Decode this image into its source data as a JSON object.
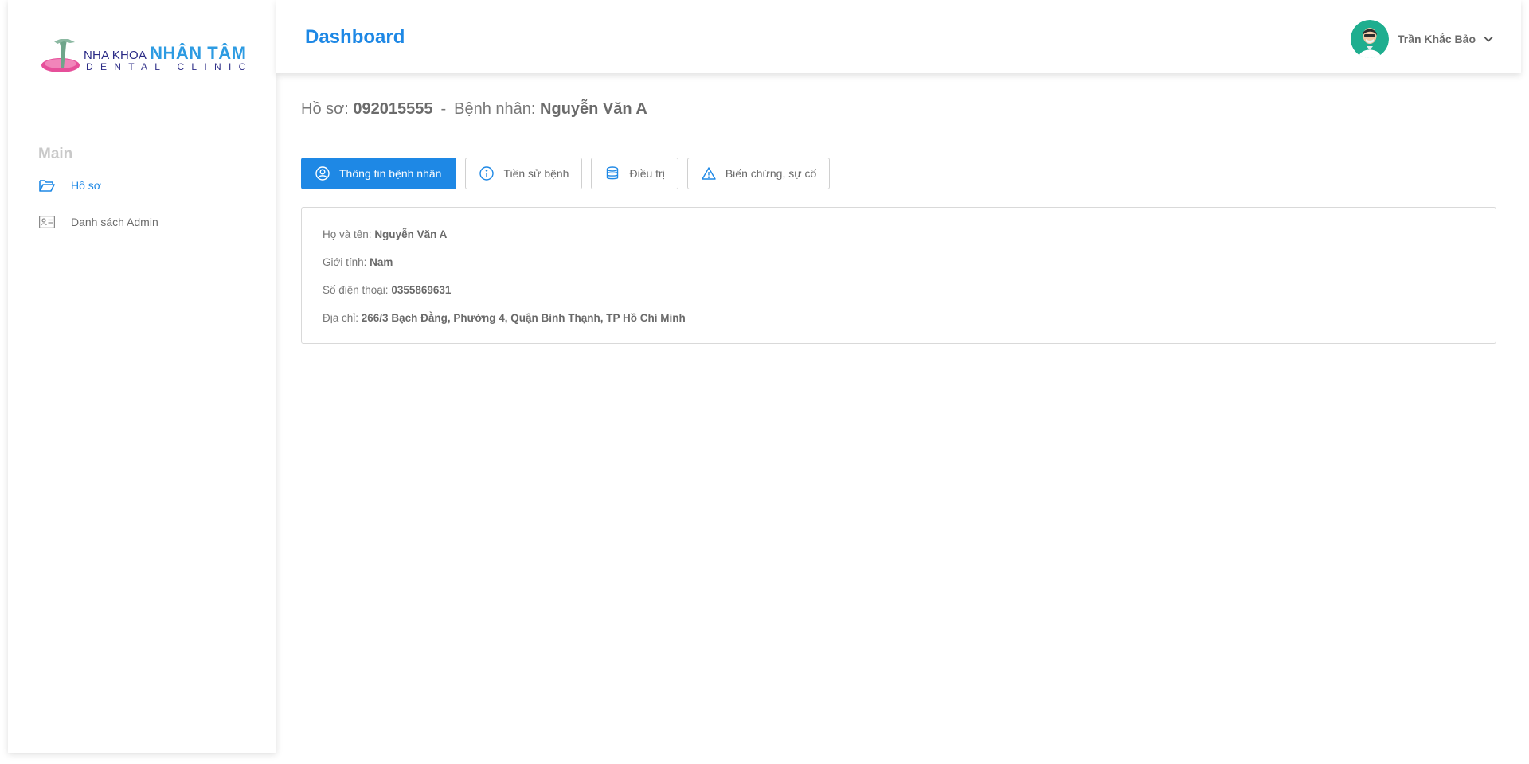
{
  "sidebar": {
    "logo": {
      "line1_small": "NHA KHOA",
      "line1_big": "NHÂN TÂM",
      "line2": "DENTAL CLINIC"
    },
    "section_title": "Main",
    "items": [
      {
        "label": "Hồ sơ",
        "icon": "folder-open-icon",
        "active": true
      },
      {
        "label": "Danh sách Admin",
        "icon": "id-card-icon",
        "active": false
      }
    ]
  },
  "header": {
    "title": "Dashboard",
    "user": {
      "name": "Trần Khắc Bảo",
      "icon": "chevron-down-icon"
    }
  },
  "record": {
    "prefix": "Hồ sơ:",
    "id": "092015555",
    "separator": "-",
    "patient_prefix": "Bệnh nhân:",
    "patient_name": "Nguyễn Văn A"
  },
  "tabs": [
    {
      "label": "Thông tin bệnh nhân",
      "icon": "user-circle-icon",
      "active": true
    },
    {
      "label": "Tiền sử bệnh",
      "icon": "info-circle-icon",
      "active": false
    },
    {
      "label": "Điều trị",
      "icon": "database-icon",
      "active": false
    },
    {
      "label": "Biến chứng, sự cố",
      "icon": "warning-icon",
      "active": false
    }
  ],
  "info": {
    "name_label": "Họ và tên:",
    "name_value": "Nguyễn Văn A",
    "gender_label": "Giới tính:",
    "gender_value": "Nam",
    "phone_label": "Số điện thoại:",
    "phone_value": "0355869631",
    "address_label": "Địa chỉ:",
    "address_value": "266/3 Bạch Đằng, Phường 4, Quận Bình Thạnh, TP Hồ Chí Minh"
  },
  "colors": {
    "accent": "#1e88e5",
    "text": "#6a6a6a",
    "muted": "#c9c9c9",
    "border": "#d9d9d9"
  }
}
